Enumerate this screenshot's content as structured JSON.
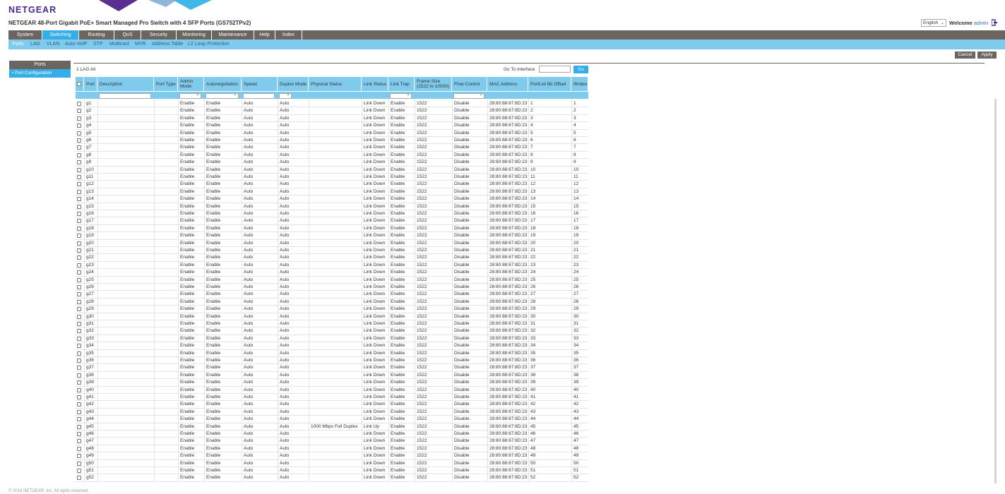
{
  "header": {
    "brand": "NETGEAR",
    "product_title": "NETGEAR 48-Port Gigabit PoE+ Smart Managed Pro Switch with 4 SFP Ports (GS752TPv2)",
    "language": "English",
    "welcome_label": "Welcome",
    "user": "admin"
  },
  "colors": {
    "accent": "#35aee8",
    "nav": "#6b6560",
    "subnav": "#7fcbee",
    "brand": "#4b2a8a"
  },
  "main_nav": [
    "System",
    "Switching",
    "Routing",
    "QoS",
    "Security",
    "Monitoring",
    "Maintenance",
    "Help",
    "Index"
  ],
  "sub_nav": [
    "Ports",
    "LAG",
    "VLAN",
    "Auto-VoIP",
    "STP",
    "Multicast",
    "MVR",
    "Address Table",
    "L2 Loop Protection"
  ],
  "buttons": {
    "cancel": "Cancel",
    "apply": "Apply",
    "go": "Go"
  },
  "sidebar": {
    "header": "Ports",
    "items": [
      "• Port Configuration"
    ]
  },
  "toolbar": {
    "lag_label": "1 LAG All",
    "goto_label": "Go To Interface"
  },
  "table": {
    "columns": [
      "Port",
      "Description",
      "Port Type",
      "Admin Mode",
      "Autonegotiation",
      "Speed",
      "Duplex Mode",
      "Physical Status",
      "Link Status",
      "Link Trap",
      "Frame Size (1522 to 10000)",
      "Flow Control",
      "MAC Address",
      "PortList Bit Offset",
      "ifIndex"
    ],
    "rows": []
  },
  "footer": "© 2018 NETGEAR, Inc. All rights reserved."
}
